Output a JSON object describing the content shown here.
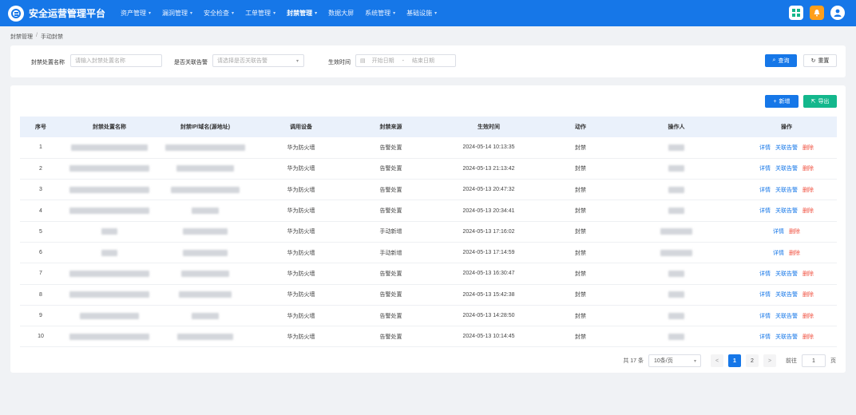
{
  "app": {
    "title": "安全运营管理平台"
  },
  "nav": [
    {
      "label": "资产管理",
      "caret": true,
      "active": false
    },
    {
      "label": "漏洞管理",
      "caret": true,
      "active": false
    },
    {
      "label": "安全检查",
      "caret": true,
      "active": false
    },
    {
      "label": "工单管理",
      "caret": true,
      "active": false
    },
    {
      "label": "封禁管理",
      "caret": true,
      "active": true
    },
    {
      "label": "数据大屏",
      "caret": false,
      "active": false
    },
    {
      "label": "系统管理",
      "caret": true,
      "active": false
    },
    {
      "label": "基础设施",
      "caret": true,
      "active": false
    }
  ],
  "breadcrumb": {
    "parent": "封禁管理",
    "separator": "/",
    "current": "手动封禁"
  },
  "filter": {
    "name_label": "封禁处置名称",
    "name_placeholder": "请输入封禁处置名称",
    "alarm_label": "是否关联告警",
    "alarm_placeholder": "请选择是否关联告警",
    "time_label": "生效时间",
    "start_placeholder": "开始日期",
    "date_separator": "-",
    "end_placeholder": "结束日期",
    "query_label": "查询",
    "reset_label": "重置"
  },
  "toolbar": {
    "add_label": "新增",
    "export_label": "导出"
  },
  "table": {
    "headers": [
      "序号",
      "封禁处置名称",
      "封禁IP/域名(源地址)",
      "调用设备",
      "封禁来源",
      "生效时间",
      "动作",
      "操作人",
      "操作"
    ],
    "rows": [
      {
        "no": "1",
        "device": "华为防火墙",
        "source": "告警处置",
        "time": "2024-05-14 10:13:35",
        "action": "封禁",
        "ops": [
          "详情",
          "关联告警",
          "删除"
        ],
        "nameW": 96,
        "ipW": 100,
        "userW": 20
      },
      {
        "no": "2",
        "device": "华为防火墙",
        "source": "告警处置",
        "time": "2024-05-13 21:13:42",
        "action": "封禁",
        "ops": [
          "详情",
          "关联告警",
          "删除"
        ],
        "nameW": 100,
        "ipW": 72,
        "userW": 20
      },
      {
        "no": "3",
        "device": "华为防火墙",
        "source": "告警处置",
        "time": "2024-05-13 20:47:32",
        "action": "封禁",
        "ops": [
          "详情",
          "关联告警",
          "删除"
        ],
        "nameW": 100,
        "ipW": 86,
        "userW": 20
      },
      {
        "no": "4",
        "device": "华为防火墙",
        "source": "告警处置",
        "time": "2024-05-13 20:34:41",
        "action": "封禁",
        "ops": [
          "详情",
          "关联告警",
          "删除"
        ],
        "nameW": 100,
        "ipW": 34,
        "userW": 20
      },
      {
        "no": "5",
        "device": "华为防火墙",
        "source": "手动新增",
        "time": "2024-05-13 17:16:02",
        "action": "封禁",
        "ops": [
          "详情",
          "删除"
        ],
        "nameW": 20,
        "ipW": 56,
        "userW": 40
      },
      {
        "no": "6",
        "device": "华为防火墙",
        "source": "手动新增",
        "time": "2024-05-13 17:14:59",
        "action": "封禁",
        "ops": [
          "详情",
          "删除"
        ],
        "nameW": 20,
        "ipW": 56,
        "userW": 40
      },
      {
        "no": "7",
        "device": "华为防火墙",
        "source": "告警处置",
        "time": "2024-05-13 16:30:47",
        "action": "封禁",
        "ops": [
          "详情",
          "关联告警",
          "删除"
        ],
        "nameW": 100,
        "ipW": 60,
        "userW": 20
      },
      {
        "no": "8",
        "device": "华为防火墙",
        "source": "告警处置",
        "time": "2024-05-13 15:42:38",
        "action": "封禁",
        "ops": [
          "详情",
          "关联告警",
          "删除"
        ],
        "nameW": 100,
        "ipW": 66,
        "userW": 20
      },
      {
        "no": "9",
        "device": "华为防火墙",
        "source": "告警处置",
        "time": "2024-05-13 14:28:50",
        "action": "封禁",
        "ops": [
          "详情",
          "关联告警",
          "删除"
        ],
        "nameW": 74,
        "ipW": 34,
        "userW": 20
      },
      {
        "no": "10",
        "device": "华为防火墙",
        "source": "告警处置",
        "time": "2024-05-13 10:14:45",
        "action": "封禁",
        "ops": [
          "详情",
          "关联告警",
          "删除"
        ],
        "nameW": 100,
        "ipW": 70,
        "userW": 20
      }
    ]
  },
  "pagination": {
    "total_label": "共 17 条",
    "page_size": "10条/页",
    "prev": "<",
    "next": ">",
    "pages": [
      "1",
      "2"
    ],
    "current_page": "1",
    "goto_label": "前往",
    "goto_value": "1",
    "page_suffix": "页"
  },
  "colors": {
    "primary": "#1677e8",
    "success": "#13b78c",
    "danger": "#f0503f",
    "bell": "#ff9f1a"
  }
}
